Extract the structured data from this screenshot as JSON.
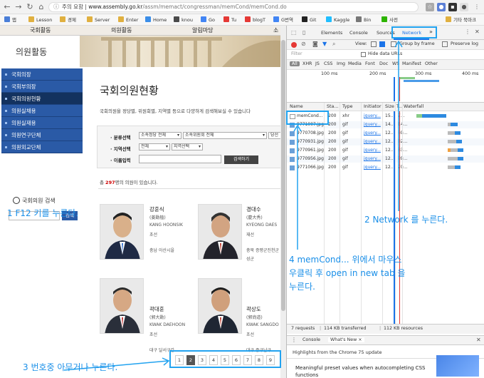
{
  "browser": {
    "url_prefix": "주의 요함 | ",
    "url_host": "www.assembly.go.kr",
    "url_path": "/assm/memact/congressman/memCond/memCond.do",
    "bookmarks": [
      "앱",
      "Lesson",
      "경제",
      "Server",
      "Enter",
      "Home",
      "knou",
      "Go",
      "Tu",
      "blogT",
      "G번역",
      "Git",
      "Kaggle",
      "Bin",
      "사전"
    ],
    "other_bookmarks": "기타 북마크"
  },
  "site": {
    "topnav": [
      "국회활동",
      "의원활동",
      "알림마당",
      "소"
    ],
    "section_title": "의원활동",
    "side_menu": [
      "국회의장",
      "국회부의장",
      "국회의원현황",
      "의원실채용",
      "의원실재용",
      "의원연구단체",
      "의원외교단체"
    ],
    "search_label": "국회의원 검색",
    "search_button": "검색",
    "page_title": "국회의원현황",
    "intro": "국회의원을 정당별, 위원회별, 지역별 등으로 다양하게 검색해보실 수 있습니다",
    "filter": {
      "label_category": "· 분류선택",
      "label_region": "· 지역선택",
      "label_name": "· 이름입력",
      "party_select": "소속정당 전체",
      "committee_select": "소속위원회 전체",
      "extra_select": "당선",
      "region_select": "전체",
      "region2_select": "지역선택",
      "search_button": "검색하기"
    },
    "result_prefix": "총 ",
    "result_count": "297",
    "result_suffix": "명의 의원이 있습니다.",
    "members": [
      {
        "name": "강훈식",
        "hanja": "(姜勳植)",
        "roman": "KANG HOONSIK",
        "term": "초선",
        "region": "충남 아산시을"
      },
      {
        "name": "경대수",
        "hanja": "(慶大秀)",
        "roman": "KYEONG DAES",
        "term": "재선",
        "region": "충북 증평군진천군",
        "region2": "성군"
      },
      {
        "name": "곽대훈",
        "hanja": "(郭大勳)",
        "roman": "KWAK DAEHOON",
        "term": "초선",
        "region": "대구 달서구갑"
      },
      {
        "name": "곽상도",
        "hanja": "(郭尙道)",
        "roman": "KWAK SANGDO",
        "term": "초선",
        "region": "대구 중구남구"
      }
    ],
    "pages": [
      "1",
      "2",
      "3",
      "4",
      "5",
      "6",
      "7",
      "8",
      "9"
    ],
    "active_page": "2"
  },
  "devtools": {
    "tabs": [
      "Elements",
      "Console",
      "Sources",
      "Network",
      "»"
    ],
    "active_tab": "Network",
    "toolbar": {
      "view_label": "View:",
      "group_by_frame": "Group by frame",
      "preserve_log": "Preserve log"
    },
    "filter_placeholder": "Filter",
    "hide_data_urls": "Hide data URLs",
    "types": [
      "All",
      "XHR",
      "JS",
      "CSS",
      "Img",
      "Media",
      "Font",
      "Doc",
      "WS",
      "Manifest",
      "Other"
    ],
    "overview_ticks": [
      "100 ms",
      "200 ms",
      "300 ms",
      "400 ms"
    ],
    "columns": [
      "Name",
      "Sta...",
      "Type",
      "Initiator",
      "Size",
      "T...",
      "Waterfall"
    ],
    "rows": [
      {
        "name": "memCond...",
        "status": "200",
        "type": "xhr",
        "initiator": "jquery...",
        "size": "15...",
        "time": "7..."
      },
      {
        "name": "9771007.jpg",
        "status": "200",
        "type": "gif",
        "initiator": "jquery...",
        "size": "14...",
        "time": "14..."
      },
      {
        "name": "9770708.jpg",
        "status": "200",
        "type": "gif",
        "initiator": "jquery...",
        "size": "12...",
        "time": "69..."
      },
      {
        "name": "9770931.jpg",
        "status": "200",
        "type": "gif",
        "initiator": "jquery...",
        "size": "12...",
        "time": "82..."
      },
      {
        "name": "9770961.jpg",
        "status": "200",
        "type": "gif",
        "initiator": "jquery...",
        "size": "12...",
        "time": "83..."
      },
      {
        "name": "9770956.jpg",
        "status": "200",
        "type": "gif",
        "initiator": "jquery...",
        "size": "12...",
        "time": "89..."
      },
      {
        "name": "9771066.jpg",
        "status": "200",
        "type": "gif",
        "initiator": "jquery...",
        "size": "12...",
        "time": "70..."
      }
    ],
    "status_requests": "7 requests",
    "status_transferred": "114 KB transferred",
    "status_resources": "112 KB resources",
    "drawer_tabs": [
      "Console",
      "What's New ×"
    ],
    "drawer_headline": "Highlights from the Chrome 75 update",
    "drawer_item": "Meaningful preset values when autocompleting CSS",
    "drawer_item2": "functions"
  },
  "annotations": {
    "step1": "1  F12  키를 누른다.",
    "step2": "2 Network 를 누른다.",
    "step3": "3 번호중 아무거나 누른다.",
    "step4_line1": "4 memCond... 위에서 마우스",
    "step4_line2": "우클릭 후 open in new tab 을",
    "step4_line3": "누른다."
  },
  "colors": {
    "accent": "#2a5aa6",
    "annotation": "#1a8fe8",
    "devtools_active": "#1a73e8"
  }
}
